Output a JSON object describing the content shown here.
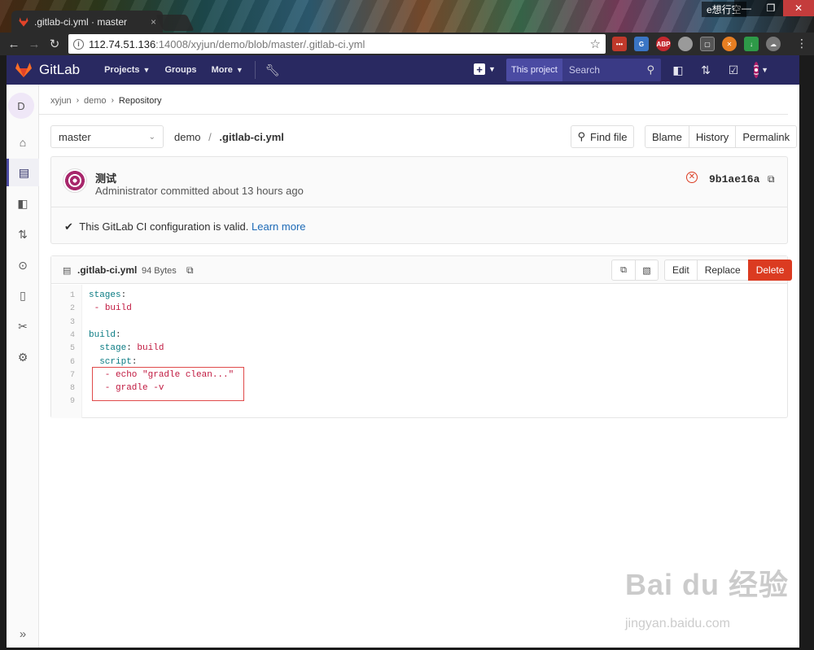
{
  "browser": {
    "tab_title": ".gitlab-ci.yml · master",
    "tab_close": "×",
    "profile": "e想行空",
    "url_host": "112.74.51.136",
    "url_path": ":14008/xyjun/demo/blob/master/.gitlab-ci.yml",
    "window_buttons": [
      "—",
      "❐",
      "✕"
    ]
  },
  "header": {
    "logo_text": "GitLab",
    "nav": [
      {
        "label": "Projects",
        "has_caret": true
      },
      {
        "label": "Groups",
        "has_caret": false
      },
      {
        "label": "More",
        "has_caret": true
      }
    ],
    "search_scope": "This project",
    "search_placeholder": "Search"
  },
  "sidebar": {
    "project_initial": "D",
    "items": [
      "home-icon",
      "repository-icon",
      "registry-icon",
      "merge-request-icon",
      "ci-icon",
      "wiki-icon",
      "snippets-icon",
      "settings-icon"
    ],
    "collapse_label": "»"
  },
  "breadcrumb": {
    "items": [
      "xyjun",
      "demo",
      "Repository"
    ]
  },
  "file_nav": {
    "branch": "master",
    "project": "demo",
    "separator": "/",
    "file_name": ".gitlab-ci.yml",
    "find_file": "Find file",
    "actions": [
      "Blame",
      "History",
      "Permalink"
    ]
  },
  "commit": {
    "title": "测试",
    "meta": "Administrator committed about 13 hours ago",
    "sha": "9b1ae16a",
    "ci_status": "This GitLab CI configuration is valid.",
    "learn_more": "Learn more"
  },
  "file": {
    "name": ".gitlab-ci.yml",
    "size": "94 Bytes",
    "edit": "Edit",
    "replace": "Replace",
    "delete": "Delete"
  },
  "code": {
    "line_numbers": [
      "1",
      "2",
      "3",
      "4",
      "5",
      "6",
      "7",
      "8",
      "9"
    ],
    "lines": [
      [
        {
          "t": "stages",
          "c": "k"
        },
        {
          "t": ":",
          "c": "p"
        }
      ],
      [
        {
          "t": " - ",
          "c": "v"
        },
        {
          "t": "build",
          "c": "v"
        }
      ],
      [],
      [
        {
          "t": "build",
          "c": "k"
        },
        {
          "t": ":",
          "c": "p"
        }
      ],
      [
        {
          "t": "  stage",
          "c": "k"
        },
        {
          "t": ": ",
          "c": "p"
        },
        {
          "t": "build",
          "c": "v"
        }
      ],
      [
        {
          "t": "  script",
          "c": "k"
        },
        {
          "t": ":",
          "c": "p"
        }
      ],
      [
        {
          "t": "   - echo \"gradle clean...\"",
          "c": "v"
        }
      ],
      [
        {
          "t": "   - gradle -v",
          "c": "v"
        }
      ],
      []
    ]
  },
  "watermark": {
    "main": "Bai du 经验",
    "sub": "jingyan.baidu.com"
  },
  "colors": {
    "header_bg": "#292961",
    "delete_red": "#db3b21",
    "link_blue": "#1b69b6",
    "yaml_key": "#0a7b83",
    "yaml_value": "#c0183f",
    "highlight_box": "#e04a4a"
  }
}
